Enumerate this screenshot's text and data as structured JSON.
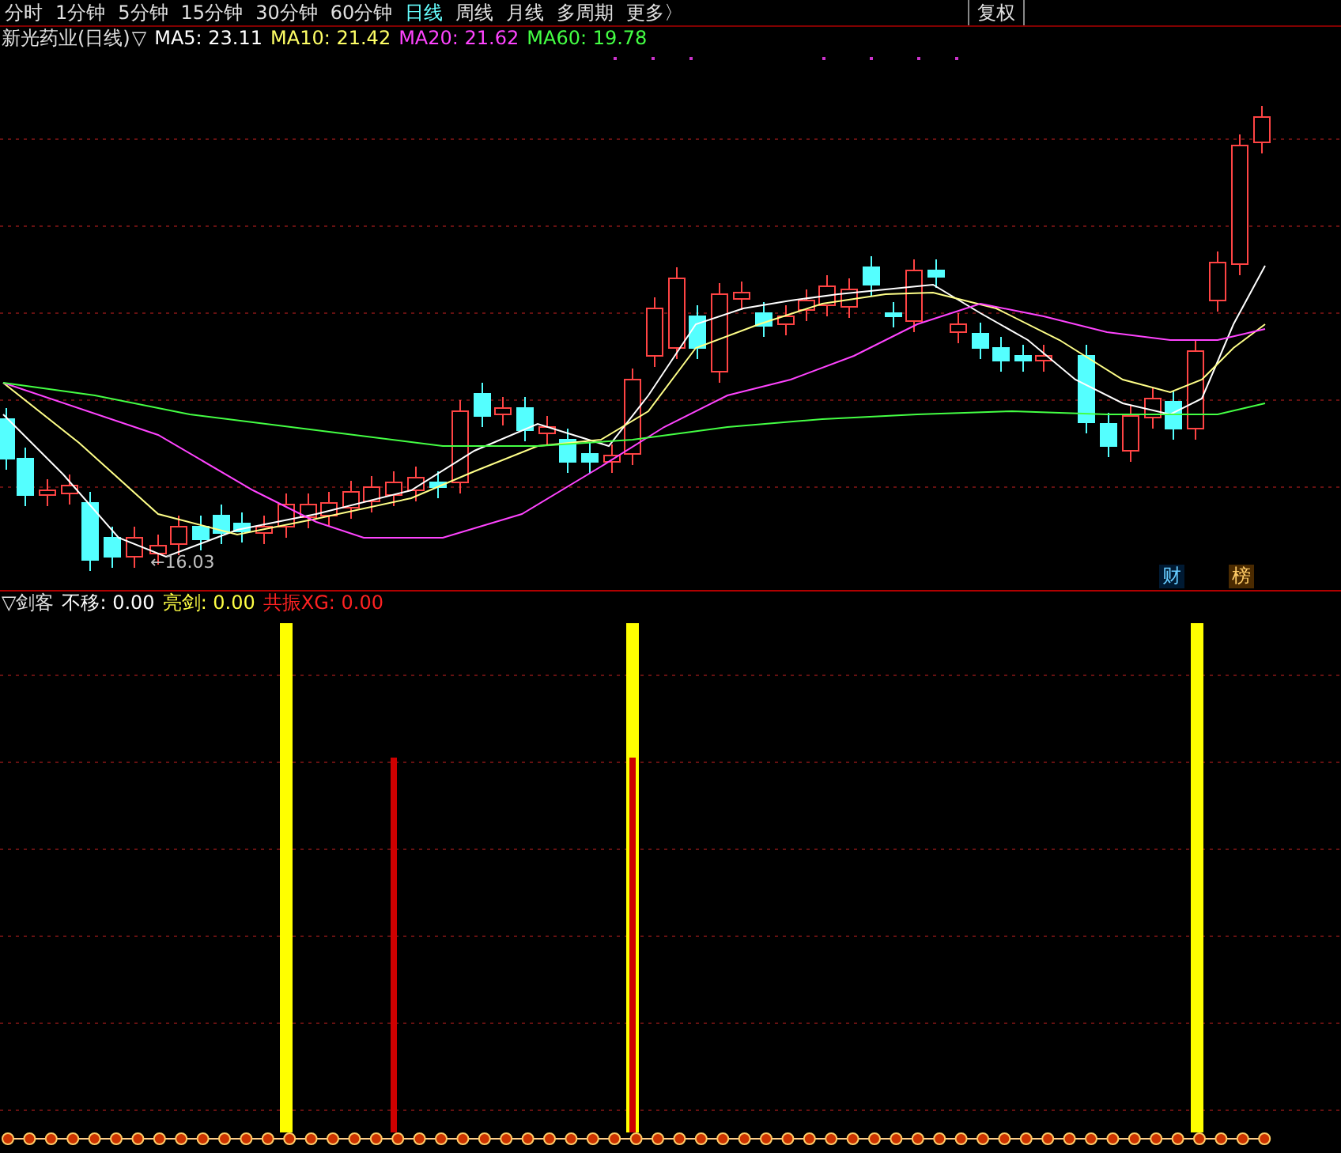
{
  "period_tabs": [
    {
      "label": "分时",
      "selected": false
    },
    {
      "label": "1分钟",
      "selected": false
    },
    {
      "label": "5分钟",
      "selected": false
    },
    {
      "label": "15分钟",
      "selected": false
    },
    {
      "label": "30分钟",
      "selected": false
    },
    {
      "label": "60分钟",
      "selected": false
    },
    {
      "label": "日线",
      "selected": true
    },
    {
      "label": "周线",
      "selected": false
    },
    {
      "label": "月线",
      "selected": false
    },
    {
      "label": "多周期",
      "selected": false
    },
    {
      "label": "更多〉",
      "selected": false
    }
  ],
  "toolbar_buttons": [
    "复权"
  ],
  "main_chart": {
    "title": "新光药业(日线)",
    "toggle": "▽",
    "indicators": [
      {
        "label": "MA5: 23.11",
        "color": "#ffffff"
      },
      {
        "label": "MA10: 21.42",
        "color": "#ffff66"
      },
      {
        "label": "MA20: 21.62",
        "color": "#ff44ff"
      },
      {
        "label": "MA60: 19.78",
        "color": "#44ff44"
      }
    ],
    "low_marker": "←16.03",
    "badges": [
      {
        "label": "财",
        "kind": "finance"
      },
      {
        "label": "榜",
        "kind": "ranking"
      }
    ]
  },
  "indicator_chart": {
    "title": "▽剑客",
    "indicators": [
      {
        "label": "不移: 0.00",
        "color": "#ffffff"
      },
      {
        "label": "亮剑: 0.00",
        "color": "#ffff44"
      },
      {
        "label": "共振XG: 0.00",
        "color": "#ff2222"
      }
    ]
  }
}
